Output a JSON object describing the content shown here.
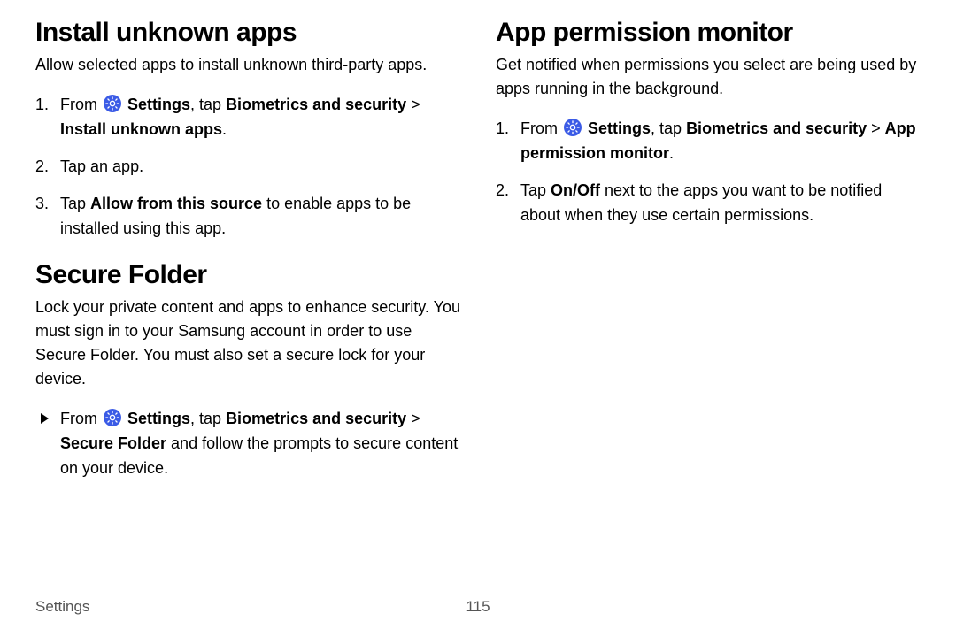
{
  "left": {
    "section1": {
      "title": "Install unknown apps",
      "intro": "Allow selected apps to install unknown third-party apps.",
      "steps": [
        {
          "pre": "From ",
          "b1": "Settings",
          "mid1": ", tap ",
          "b2": "Biometrics and security",
          "chev": " > ",
          "b3": "Install unknown apps",
          "post": "."
        },
        {
          "text": "Tap an app."
        },
        {
          "pre": "Tap ",
          "b1": "Allow from this source",
          "post": " to enable apps to be installed using this app."
        }
      ]
    },
    "section2": {
      "title": "Secure Folder",
      "intro": "Lock your private content and apps to enhance security. You must sign in to your Samsung account in order to use Secure Folder. You must also set a secure lock for your device.",
      "bullet": {
        "pre": "From ",
        "b1": "Settings",
        "mid1": ", tap ",
        "b2": "Biometrics and security",
        "chev": " > ",
        "b3": "Secure Folder",
        "post": " and follow the prompts to secure content on your device."
      }
    }
  },
  "right": {
    "section1": {
      "title": "App permission monitor",
      "intro": "Get notified when permissions you select are being used by apps running in the background.",
      "steps": [
        {
          "pre": "From ",
          "b1": "Settings",
          "mid1": ", tap ",
          "b2": "Biometrics and security",
          "chev": " > ",
          "b3": "App permission monitor",
          "post": "."
        },
        {
          "pre": "Tap ",
          "b1": "On/Off",
          "post": " next to the apps you want to be notified about when they use certain permissions."
        }
      ]
    }
  },
  "footer": {
    "section": "Settings",
    "page": "115"
  }
}
